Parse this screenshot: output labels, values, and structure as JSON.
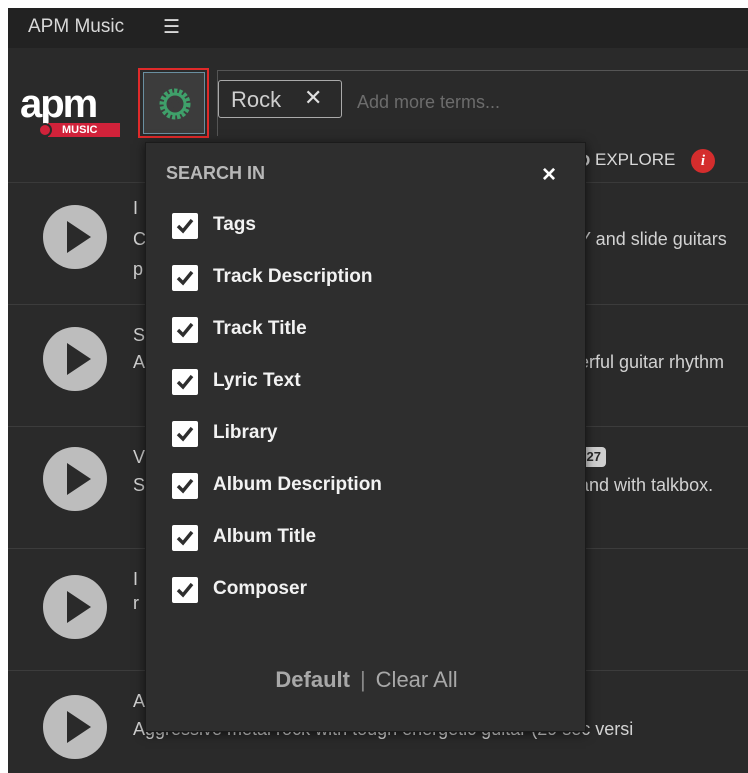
{
  "titlebar": {
    "title": "APM Music",
    "menu_icon": "☰"
  },
  "logo": {
    "text": "apm",
    "sub": "MUSIC"
  },
  "search": {
    "chip_label": "Rock",
    "chip_remove": "✕",
    "placeholder": "Add more terms..."
  },
  "explore": {
    "label": "EXPLORE",
    "prefix_glyph": "D",
    "info": "i"
  },
  "tracks": [
    {
      "frag_title": "I",
      "frag_desc": "C",
      "frag_desc2": "p",
      "right_text": "Y and slide guitars"
    },
    {
      "frag_title": "S",
      "frag_desc": "A",
      "right_text": "erful guitar rhythm"
    },
    {
      "frag_title": "V",
      "frag_desc": "S",
      "badge": "27",
      "right_text": "and with talkbox."
    },
    {
      "frag_title": "I",
      "frag_desc": "r",
      "right_text": ""
    },
    {
      "frag_title": "A",
      "frag_desc": "",
      "right_text": "Aggressive metal rock with tough energetic guitar (29 sec versi"
    }
  ],
  "dropdown": {
    "title": "SEARCH IN",
    "close": "×",
    "options": [
      {
        "label": "Tags",
        "checked": true
      },
      {
        "label": "Track Description",
        "checked": true
      },
      {
        "label": "Track Title",
        "checked": true
      },
      {
        "label": "Lyric Text",
        "checked": true
      },
      {
        "label": "Library",
        "checked": true
      },
      {
        "label": "Album Description",
        "checked": true
      },
      {
        "label": "Album Title",
        "checked": true
      },
      {
        "label": "Composer",
        "checked": true
      }
    ],
    "footer": {
      "default_label": "Default",
      "separator": "|",
      "clear_label": "Clear All"
    }
  },
  "colors": {
    "accent_red": "#d1223a",
    "gear_green": "#3fa06a",
    "highlight_border": "#e02a2a"
  }
}
